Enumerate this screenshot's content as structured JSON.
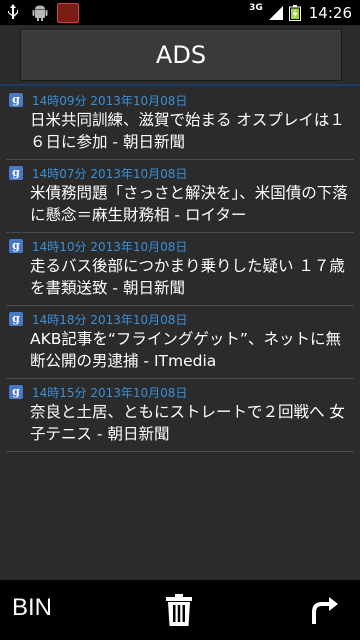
{
  "status_bar": {
    "network": "3G",
    "time": "14:26"
  },
  "header": {
    "title": "ADS"
  },
  "news": [
    {
      "time": "14時09分 2013年10月08日",
      "headline": "日米共同訓練、滋賀で始まる オスプレイは１６日に参加 - 朝日新聞"
    },
    {
      "time": "14時07分 2013年10月08日",
      "headline": "米債務問題「さっさと解決を」、米国債の下落に懸念＝麻生財務相 - ロイター"
    },
    {
      "time": "14時10分 2013年10月08日",
      "headline": "走るバス後部につかまり乗りした疑い １７歳を書類送致 - 朝日新聞"
    },
    {
      "time": "14時18分 2013年10月08日",
      "headline": "AKB記事を“フライングゲット”、ネットに無断公開の男逮捕 - ITmedia"
    },
    {
      "time": "14時15分 2013年10月08日",
      "headline": "奈良と土居、ともにストレートで２回戦へ 女子テニス - 朝日新聞"
    }
  ],
  "bottom_bar": {
    "bin_label": "BIN"
  },
  "colors": {
    "time_blue": "#3b8fd8",
    "background": "#2b2b2b"
  }
}
